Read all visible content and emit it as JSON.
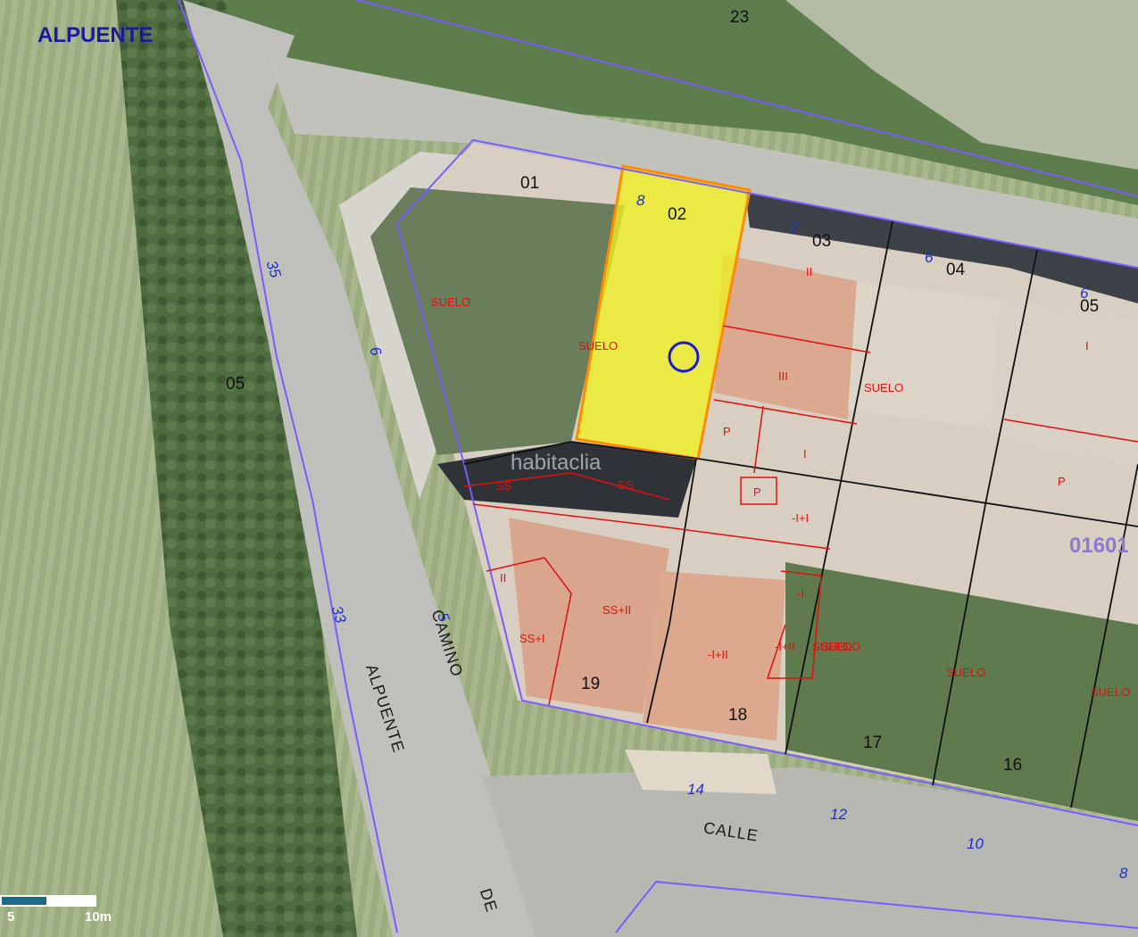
{
  "map": {
    "place_name": "ALPUENTE",
    "block_id": "01601",
    "watermark": "habitaclia",
    "streets": {
      "camino_a": "CAMINO",
      "camino_b": "DE",
      "camino_c": "ALPUENTE",
      "calle": "CALLE"
    },
    "parcels": [
      "23",
      "01",
      "02",
      "03",
      "04",
      "05",
      "05",
      "19",
      "18",
      "17",
      "16"
    ],
    "house_numbers": [
      "8",
      "7",
      "6",
      "6",
      "35",
      "6",
      "5",
      "33",
      "14",
      "12",
      "10",
      "8"
    ],
    "categories": [
      "SUELO",
      "SUELO",
      "SUELO",
      "SUELO",
      "SUELO",
      "SUELO",
      "II",
      "III",
      "P",
      "I",
      "P",
      "I",
      "P",
      "-I+I",
      "SS",
      "SS",
      "II",
      "SS+II",
      "SS+I",
      "-I+II",
      "-I+II",
      "-I",
      "SUELO"
    ],
    "scale": {
      "label_a": "5",
      "label_b": "10m"
    },
    "colors": {
      "highlight": "#f0f020",
      "highlight_border": "#ff8c00",
      "parcel_line": "#7a5cff",
      "subparcel_line": "#e01010",
      "marker": "#1a1ad0"
    }
  }
}
